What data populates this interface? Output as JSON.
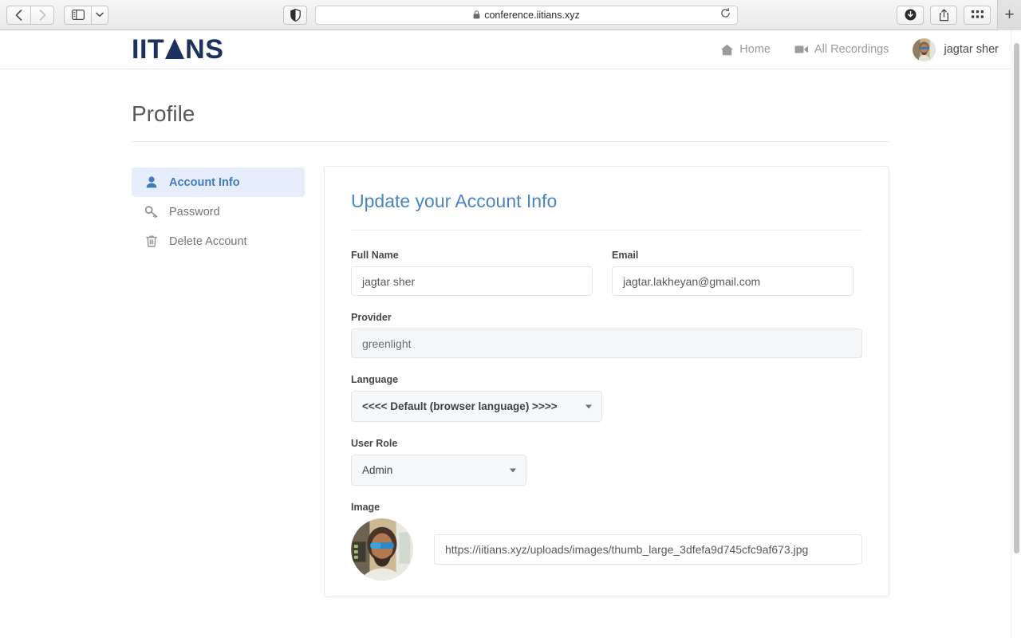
{
  "browser": {
    "back_label": "Back",
    "forward_label": "Forward",
    "sidebar_label": "Show sidebar",
    "sidebar_menu_label": "Sidebar options",
    "shield_label": "Privacy report",
    "url": "conference.iitians.xyz",
    "lock_glyph": "🔒",
    "reload_label": "Reload",
    "downloads_label": "Downloads",
    "share_label": "Share",
    "tabs_overview_label": "Tab overview",
    "new_tab_label": "+"
  },
  "header": {
    "logo_part1": "IIT",
    "logo_part2": "NS",
    "nav": [
      {
        "label": "Home",
        "icon": "home-icon"
      },
      {
        "label": "All Recordings",
        "icon": "video-camera-icon"
      }
    ],
    "user": {
      "name": "jagtar sher",
      "avatar": "user-photo"
    }
  },
  "page": {
    "title": "Profile"
  },
  "sidebar": {
    "items": [
      {
        "label": "Account Info",
        "icon": "user-icon",
        "active": true
      },
      {
        "label": "Password",
        "icon": "key-icon",
        "active": false
      },
      {
        "label": "Delete Account",
        "icon": "trash-icon",
        "active": false
      }
    ]
  },
  "main": {
    "card_title": "Update your Account Info",
    "fields": {
      "full_name": {
        "label": "Full Name",
        "value": "jagtar sher"
      },
      "email": {
        "label": "Email",
        "value": "jagtar.lakheyan@gmail.com"
      },
      "provider": {
        "label": "Provider",
        "value": "greenlight"
      },
      "language": {
        "label": "Language",
        "value": "<<<< Default (browser language) >>>>"
      },
      "user_role": {
        "label": "User Role",
        "value": "Admin"
      },
      "image": {
        "label": "Image",
        "url": "https://iitians.xyz/uploads/images/thumb_large_3dfefa9d745cfc9af673.jpg"
      }
    }
  },
  "colors": {
    "brand_navy": "#1e3060",
    "accent_blue": "#4a84c4",
    "active_bg": "#e6eefb",
    "muted_text": "#9b9b9b"
  }
}
